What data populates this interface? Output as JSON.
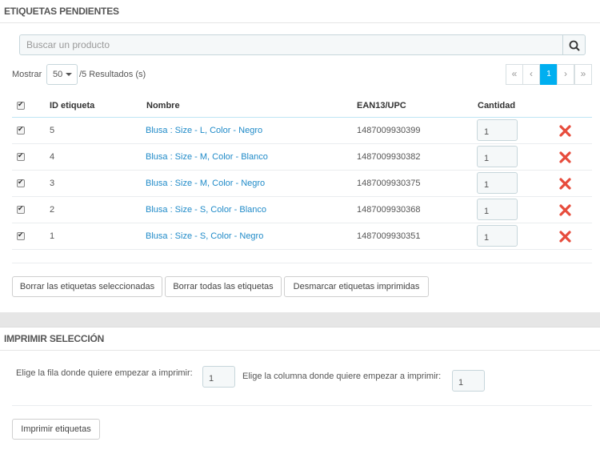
{
  "section1": {
    "title": "ETIQUETAS PENDIENTES"
  },
  "search": {
    "placeholder": "Buscar un producto",
    "icon": "search-icon"
  },
  "listing": {
    "show_label": "Mostrar",
    "per_page": "50",
    "results": "/5 Resultados (s)"
  },
  "pagination": {
    "first": "«",
    "prev": "‹",
    "current": "1",
    "next": "›",
    "last": "»"
  },
  "table": {
    "headers": {
      "id": "ID etiqueta",
      "name": "Nombre",
      "ean": "EAN13/UPC",
      "qty": "Cantidad"
    },
    "rows": [
      {
        "id": "5",
        "name": "Blusa : Size - L, Color - Negro",
        "ean": "1487009930399",
        "qty": "1"
      },
      {
        "id": "4",
        "name": "Blusa : Size - M, Color - Blanco",
        "ean": "1487009930382",
        "qty": "1"
      },
      {
        "id": "3",
        "name": "Blusa : Size - M, Color - Negro",
        "ean": "1487009930375",
        "qty": "1"
      },
      {
        "id": "2",
        "name": "Blusa : Size - S, Color - Blanco",
        "ean": "1487009930368",
        "qty": "1"
      },
      {
        "id": "1",
        "name": "Blusa : Size - S, Color - Negro",
        "ean": "1487009930351",
        "qty": "1"
      }
    ]
  },
  "actions": {
    "delete_selected": "Borrar las etiquetas seleccionadas",
    "delete_all": "Borrar todas las etiquetas",
    "unmark_printed": "Desmarcar etiquetas imprimidas"
  },
  "section2": {
    "title": "IMPRIMIR SELECCIÓN",
    "row_label": "Elige la fila donde quiere empezar a imprimir:",
    "row_value": "1",
    "col_label": "Elige la columna donde quiere empezar a imprimir:",
    "col_value": "1",
    "print_button": "Imprimir etiquetas"
  },
  "colors": {
    "accent": "#00aff0",
    "link": "#1f8ac8",
    "delete": "#e74c3c"
  }
}
